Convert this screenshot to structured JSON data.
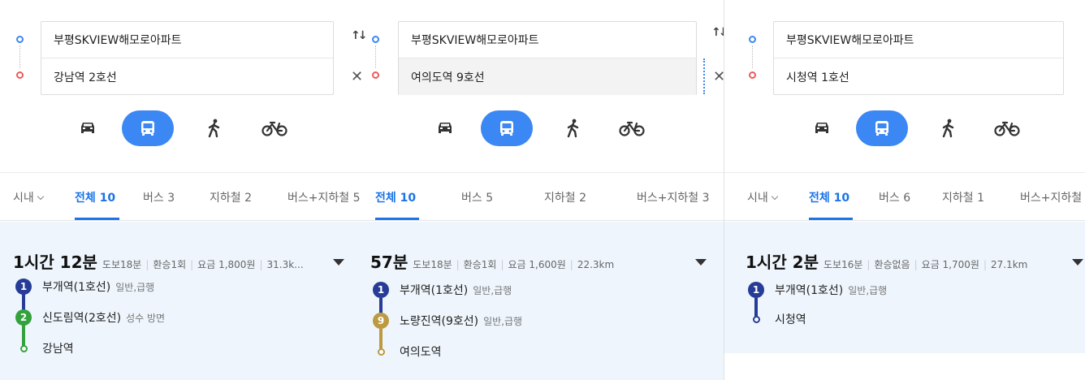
{
  "panels": [
    {
      "origin": "부평SKVIEW해모로아파트",
      "destination": "강남역 2호선",
      "swap_icon": "swap-vertical-icon",
      "clear_icon": "close-icon",
      "modes": [
        "car-icon",
        "bus-icon",
        "walk-icon",
        "bike-icon"
      ],
      "active_mode": "bus-icon",
      "area_filter": "시내",
      "tabs": [
        "전체 10",
        "버스 3",
        "지하철 2",
        "버스+지하철 5"
      ],
      "active_tab": "전체 10",
      "result": {
        "duration": "1시간 12분",
        "walk": "도보18분",
        "transfer": "환승1회",
        "fare": "요금 1,800원",
        "distance": "31.3k...",
        "steps": [
          {
            "badge": "1",
            "line_color": "#263c96",
            "station": "부개역(1호선)",
            "desc": "일반,급행"
          },
          {
            "badge": "2",
            "line_color": "#33a23d",
            "station": "신도림역(2호선)",
            "desc": "성수 방면"
          },
          {
            "badge": "",
            "line_color": "#33a23d",
            "station": "강남역",
            "desc": ""
          }
        ]
      }
    },
    {
      "origin": "부평SKVIEW해모로아파트",
      "destination": "여의도역 9호선",
      "swap_icon": "swap-vertical-icon",
      "clear_icon": "close-icon",
      "modes": [
        "car-icon",
        "bus-icon",
        "walk-icon",
        "bike-icon"
      ],
      "active_mode": "bus-icon",
      "tabs": [
        "전체 10",
        "버스 5",
        "지하철 2",
        "버스+지하철 3"
      ],
      "active_tab": "전체 10",
      "result": {
        "duration": "57분",
        "walk": "도보18분",
        "transfer": "환승1회",
        "fare": "요금 1,600원",
        "distance": "22.3km",
        "steps": [
          {
            "badge": "1",
            "line_color": "#263c96",
            "station": "부개역(1호선)",
            "desc": "일반,급행"
          },
          {
            "badge": "9",
            "line_color": "#bd9a41",
            "station": "노량진역(9호선)",
            "desc": "일반,급행"
          },
          {
            "badge": "",
            "line_color": "#bd9a41",
            "station": "여의도역",
            "desc": ""
          }
        ]
      }
    },
    {
      "origin": "부평SKVIEW해모로아파트",
      "destination": "시청역 1호선",
      "modes": [
        "car-icon",
        "bus-icon",
        "walk-icon",
        "bike-icon"
      ],
      "active_mode": "bus-icon",
      "area_filter": "시내",
      "tabs": [
        "전체 10",
        "버스 6",
        "지하철 1",
        "버스+지하철"
      ],
      "active_tab": "전체 10",
      "result": {
        "duration": "1시간 2분",
        "walk": "도보16분",
        "transfer": "환승없음",
        "fare": "요금 1,700원",
        "distance": "27.1km",
        "steps": [
          {
            "badge": "1",
            "line_color": "#263c96",
            "station": "부개역(1호선)",
            "desc": "일반,급행"
          },
          {
            "badge": "",
            "line_color": "#263c96",
            "station": "시청역",
            "desc": ""
          }
        ]
      }
    }
  ],
  "colors": {
    "accent": "#3b87f3",
    "tab_active": "#1a73e8",
    "result_bg": "#eef5fc",
    "line_1": "#263c96",
    "line_2": "#33a23d",
    "line_9": "#bd9a41",
    "origin_pin": "#3b87f3",
    "destination_pin": "#ee5a5a"
  }
}
